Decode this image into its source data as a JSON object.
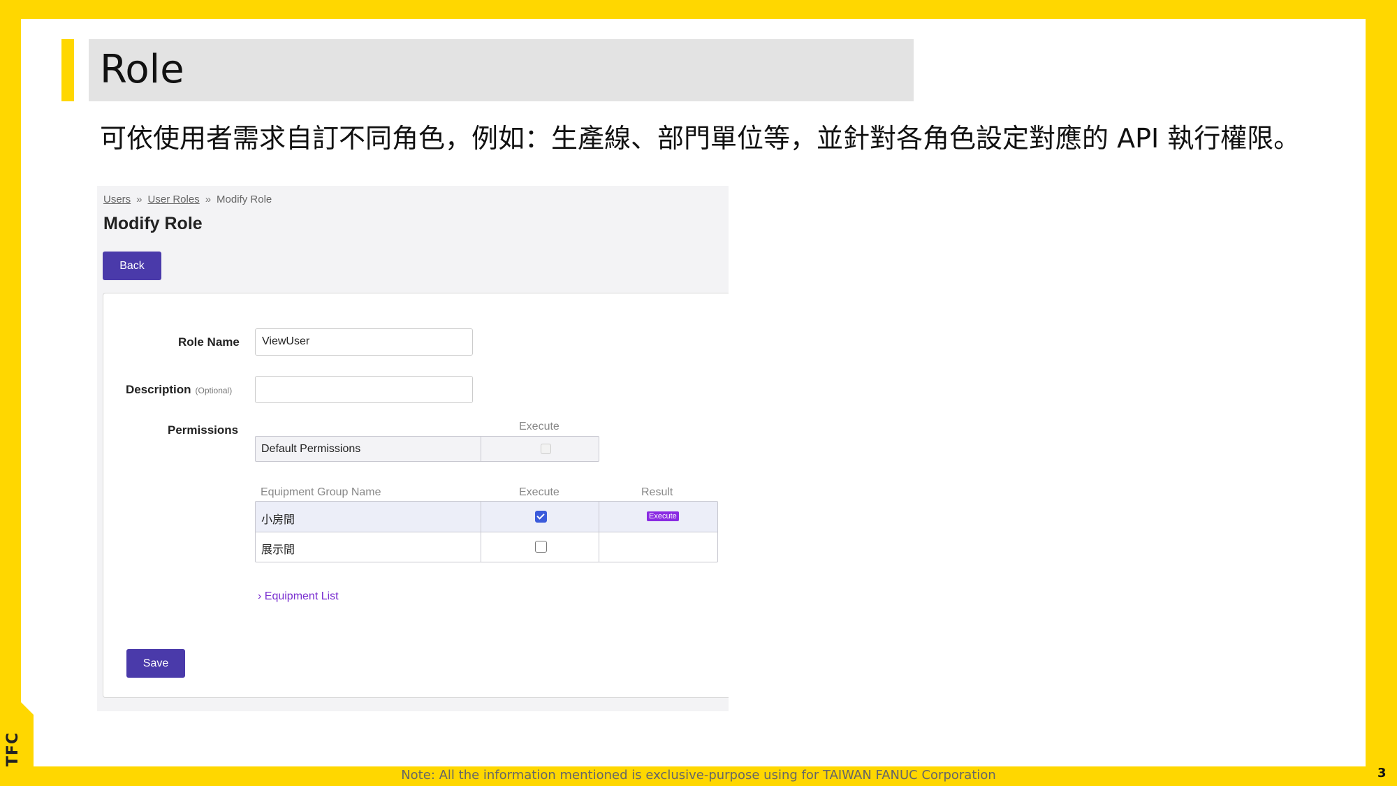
{
  "slide": {
    "title": "Role",
    "subtitle": "可依使用者需求自訂不同角色，例如：生產線、部門單位等，並針對各角色設定對應的 API 執行權限。",
    "footer_note": "Note: All the information mentioned is exclusive-purpose using for TAIWAN FANUC Corporation",
    "page_number": "3",
    "logo_text": "TFC",
    "accent_color": "#ffd700"
  },
  "ui": {
    "breadcrumb": [
      {
        "label": "Users",
        "link": true
      },
      {
        "label": "User Roles",
        "link": true
      },
      {
        "label": "Modify Role",
        "link": false
      }
    ],
    "breadcrumb_separator": "»",
    "title": "Modify Role",
    "back_label": "Back",
    "form": {
      "role_name_label": "Role Name",
      "role_name_value": "ViewUser",
      "description_label": "Description",
      "description_optional": "(Optional)",
      "description_value": "",
      "permissions_label": "Permissions"
    },
    "default_permissions": {
      "execute_header": "Execute",
      "row_label": "Default Permissions",
      "execute_checked": false,
      "execute_disabled": true
    },
    "equipment_groups": {
      "headers": {
        "name": "Equipment Group Name",
        "execute": "Execute",
        "result": "Result"
      },
      "rows": [
        {
          "name": "小房間",
          "execute_checked": true,
          "result": "Execute"
        },
        {
          "name": "展示間",
          "execute_checked": false,
          "result": ""
        }
      ]
    },
    "equipment_list_link": "› Equipment List",
    "save_label": "Save",
    "button_color": "#4a3aaa",
    "badge_color": "#8a2be2"
  }
}
